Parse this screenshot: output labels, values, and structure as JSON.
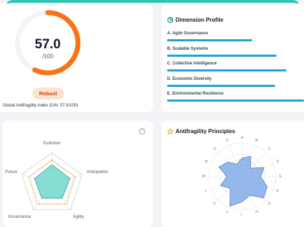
{
  "gauge": {
    "score": "57.0",
    "max_label": "/100",
    "value": 57,
    "max": 100,
    "track_color": "#f3f4f6",
    "fill_color": "#f97316"
  },
  "status_badge": "Robust",
  "gai_label": "Global Antifragility Index (GAI: 57.0/100)",
  "dimension_profile": {
    "title": "Dimension Profile",
    "bar_color": "#1aa3d6",
    "items": [
      {
        "label": "A. Agile Governance",
        "value": 0.62
      },
      {
        "label": "B. Scalable Systems",
        "value": 0.8
      },
      {
        "label": "C. Collective Intelligence",
        "value": 0.87
      },
      {
        "label": "D. Economic Diversity",
        "value": 0.79
      },
      {
        "label": "E. Environmental Resilience",
        "value": 1.0
      }
    ]
  },
  "radar": {
    "help_symbol": "?",
    "axes": [
      "Evolution",
      "Anticipation",
      "Agility",
      "Governance",
      "Future"
    ],
    "values": [
      0.62,
      0.6,
      0.55,
      0.55,
      0.58
    ],
    "fill_color": "#5fd3c4",
    "ring_color": "#f59e0b"
  },
  "principles": {
    "title": "Antifragility Principles",
    "fill_color": "#7aa7e8",
    "axis_letters": [
      "A",
      "B",
      "C",
      "D",
      "E",
      "F",
      "G",
      "H",
      "I",
      "J",
      "K",
      "L",
      "M",
      "N",
      "O",
      "P"
    ],
    "values": [
      0.55,
      0.65,
      0.35,
      0.7,
      0.55,
      0.8,
      0.9,
      0.6,
      0.75,
      0.95,
      0.5,
      0.7,
      0.45,
      0.75,
      0.6,
      0.4
    ]
  }
}
